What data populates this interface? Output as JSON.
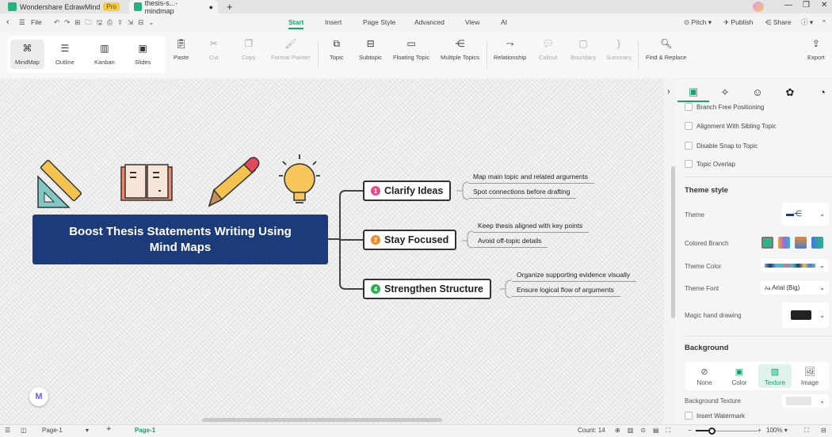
{
  "titlebar": {
    "app_tab": "Wondershare EdrawMind",
    "pro_badge": "Pro",
    "doc_tab": "thesis-s...-mindmap",
    "new_tab": "+"
  },
  "menu": {
    "file": "File",
    "tabs": [
      "Start",
      "Insert",
      "Page Style",
      "Advanced",
      "View",
      "AI"
    ],
    "active": "Start",
    "pitch": "Pitch",
    "publish": "Publish",
    "share": "Share"
  },
  "ribbon": {
    "views": [
      "MindMap",
      "Outline",
      "Kanban",
      "Slides"
    ],
    "paste": "Paste",
    "cut": "Cut",
    "copy": "Copy",
    "format_painter": "Format Painter",
    "topic": "Topic",
    "subtopic": "Subtopic",
    "floating_topic": "Floating Topic",
    "multiple_topics": "Multiple Topics",
    "relationship": "Relationship",
    "callout": "Callout",
    "boundary": "Boundary",
    "summary": "Summary",
    "find_replace": "Find & Replace",
    "export": "Export"
  },
  "mindmap": {
    "root": "Boost Thesis Statements Writing Using Mind Maps",
    "branches": [
      {
        "num": "1",
        "label": "Clarify Ideas",
        "color": "#e84a8a",
        "subs": [
          "Map main topic and related arguments",
          "Spot connections before drafting"
        ]
      },
      {
        "num": "2",
        "label": "Stay Focused",
        "color": "#f08a24",
        "subs": [
          "Keep thesis aligned with key points",
          "Avoid off-topic details"
        ]
      },
      {
        "num": "4",
        "label": "Strengthen Structure",
        "color": "#1fb54a",
        "subs": [
          "Organize supporting evidence visually",
          "Ensure logical flow of arguments"
        ]
      }
    ]
  },
  "panel": {
    "checkboxes": [
      "Branch Free Positioning",
      "Alignment With Sibling Topic",
      "Disable Snap to Topic",
      "Topic Overlap"
    ],
    "theme_style": "Theme style",
    "theme": "Theme",
    "colored_branch": "Colored Branch",
    "theme_color": "Theme Color",
    "theme_font": "Theme Font",
    "theme_font_value": "Arial (Big)",
    "font_prefix": "Aa",
    "magic": "Magic hand drawing",
    "background": "Background",
    "bg_options": [
      "None",
      "Color",
      "Texture",
      "Image"
    ],
    "bg_active": "Texture",
    "bg_texture": "Background Texture",
    "watermark": "Insert Watermark"
  },
  "status": {
    "page_select": "Page-1",
    "page_tab": "Page-1",
    "count": "Count: 14",
    "zoom": "100%",
    "add": "+"
  },
  "colors": {
    "accent": "#16a06d",
    "root": "#1b3b7a"
  }
}
